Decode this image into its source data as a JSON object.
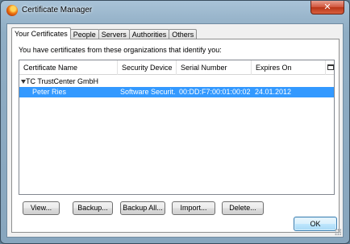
{
  "window": {
    "title": "Certificate Manager",
    "close_glyph": "✕"
  },
  "tabs": [
    {
      "label": "Your Certificates",
      "active": true
    },
    {
      "label": "People"
    },
    {
      "label": "Servers"
    },
    {
      "label": "Authorities"
    },
    {
      "label": "Others"
    }
  ],
  "intro_text": "You have certificates from these organizations that identify you:",
  "table": {
    "columns": [
      "Certificate Name",
      "Security Device",
      "Serial Number",
      "Expires On"
    ],
    "groups": [
      {
        "name": "TC TrustCenter GmbH",
        "rows": [
          {
            "name": "Peter Ries",
            "device": "Software Securit...",
            "serial": "00:DD:F7:00:01:00:02:0...",
            "expires": "24.01.2012",
            "selected": true
          }
        ]
      }
    ]
  },
  "buttons": {
    "view": "View...",
    "backup": "Backup...",
    "backup_all": "Backup All...",
    "import": "Import...",
    "delete": "Delete..."
  },
  "ok_label": "OK",
  "icons": {
    "app": "firefox-icon",
    "close": "close-icon",
    "column_picker": "column-picker-icon",
    "expand": "expand-triangle-icon"
  },
  "colors": {
    "selection": "#3399ff",
    "title_bar": "#9ab6cc"
  }
}
